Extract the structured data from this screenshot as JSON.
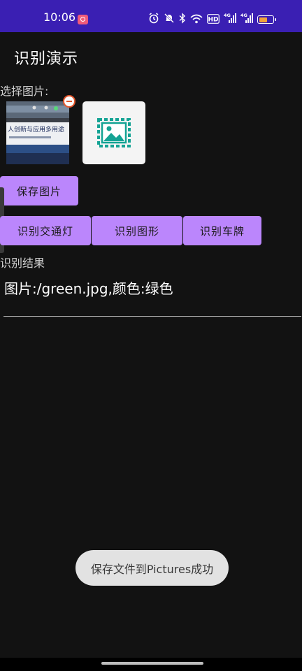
{
  "status_bar": {
    "time": "10:06",
    "bg_color": "#3a1fb3",
    "icons": [
      "screen-record-icon",
      "alarm-icon",
      "mute-icon",
      "bluetooth-icon",
      "wifi-icon",
      "hd-icon",
      "signal-4g-icon",
      "signal-4g-icon",
      "battery-icon"
    ],
    "hd_label": "HD",
    "net_label_1": "4G",
    "net_label_2": "4G",
    "battery_level": 0.6,
    "battery_color": "#f2a33a"
  },
  "app_bar": {
    "title": "识别演示"
  },
  "image_picker": {
    "label": "选择图片:",
    "photo_caption": "人创新与应用多用途",
    "add_icon": "image-placeholder-icon",
    "remove_icon": "remove-icon"
  },
  "actions": {
    "save_label": "保存图片",
    "traffic_light_label": "识别交通灯",
    "shape_label": "识别图形",
    "plate_label": "识别车牌",
    "accent_color": "#bb86fc"
  },
  "result": {
    "label": "识别结果",
    "text": "图片:/green.jpg,颜色:绿色"
  },
  "toast": {
    "message": "保存文件到Pictures成功"
  }
}
